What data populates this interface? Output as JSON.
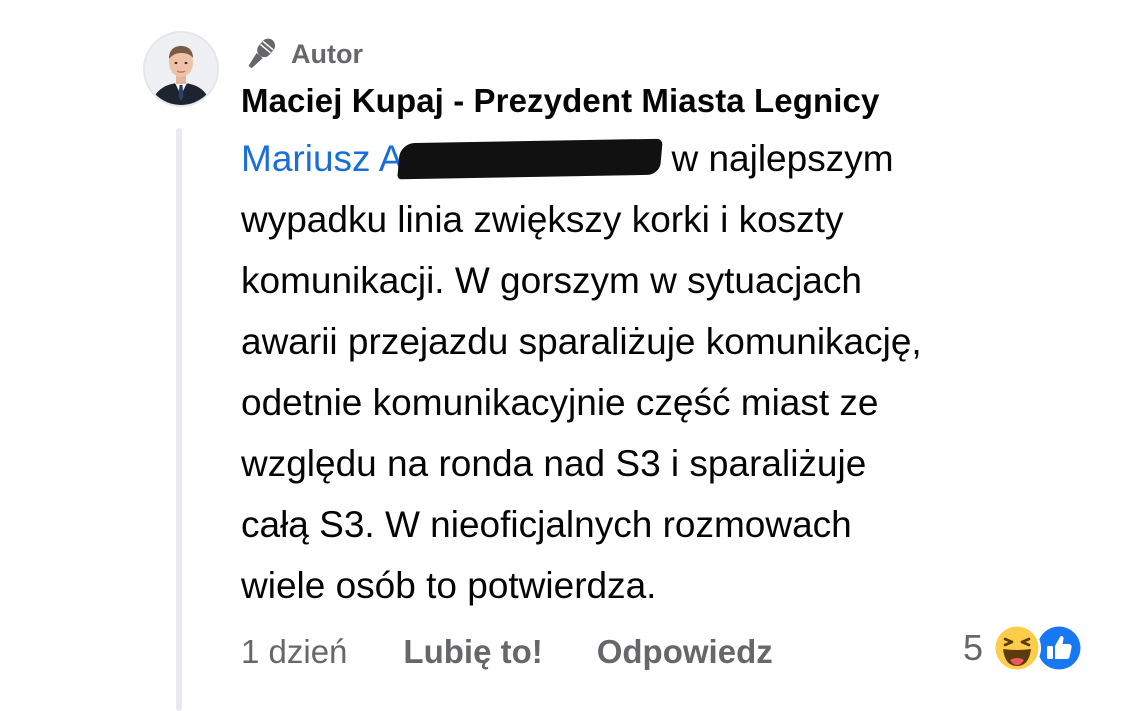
{
  "comment": {
    "author_badge": "Autor",
    "author_name": "Maciej Kupaj - Prezydent Miasta Legnicy",
    "mention": "Mariusz A",
    "lines": [
      "w najlepszym",
      "wypadku linia zwiększy korki i koszty",
      "komunikacji. W gorszym w sytuacjach",
      "awarii przejazdu sparaliżuje komunikację,",
      "odetnie komunikacyjnie część miast ze",
      "względu na ronda nad S3 i sparaliżuje",
      "całą S3. W nieoficjalnych rozmowach",
      "wiele osób to potwierdza."
    ],
    "timestamp": "1 dzień",
    "like_label": "Lubię to!",
    "reply_label": "Odpowiedz",
    "reaction_count": "5",
    "reaction_icons": [
      "haha-emoji-icon",
      "like-thumb-icon"
    ]
  },
  "colors": {
    "mention": "#1b6ed6",
    "secondary_text": "#65676b",
    "primary_text": "#050505",
    "like_blue": "#1877f2",
    "haha_yellow": "#fbcd4a"
  }
}
